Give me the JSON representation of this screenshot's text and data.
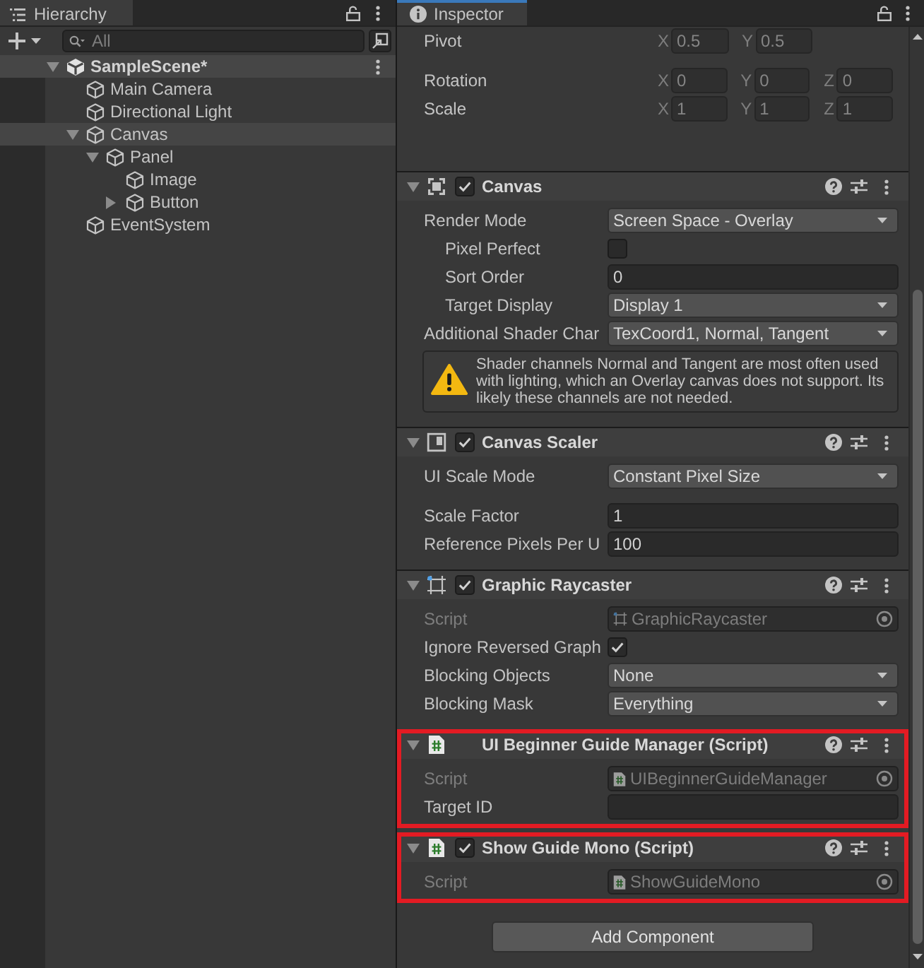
{
  "hierarchy": {
    "tab": {
      "label": "Hierarchy",
      "focused": false
    },
    "search": {
      "placeholder": "All"
    },
    "scene": {
      "name": "SampleScene*",
      "expanded": true,
      "children": [
        {
          "name": "Main Camera",
          "highlighted": false
        },
        {
          "name": "Directional Light",
          "highlighted": false
        },
        {
          "name": "Canvas",
          "highlighted": true,
          "expanded": true,
          "children": [
            {
              "name": "Panel",
              "highlighted": false,
              "expanded": true,
              "children": [
                {
                  "name": "Image",
                  "highlighted": false
                },
                {
                  "name": "Button",
                  "highlighted": false,
                  "expanded": false
                }
              ]
            }
          ]
        },
        {
          "name": "EventSystem",
          "highlighted": false
        }
      ]
    }
  },
  "inspector": {
    "tab": {
      "label": "Inspector",
      "focused": true
    },
    "transform": [
      [
        {
          "label": "Pivot",
          "disabled": true,
          "axes": [
            {
              "axis": "X",
              "value": "0.5"
            },
            {
              "axis": "Y",
              "value": "0.5"
            }
          ]
        }
      ],
      [
        {
          "label": "Rotation",
          "disabled": true,
          "axes": [
            {
              "axis": "X",
              "value": "0"
            },
            {
              "axis": "Y",
              "value": "0"
            },
            {
              "axis": "Z",
              "value": "0"
            }
          ]
        },
        {
          "label": "Scale",
          "disabled": true,
          "axes": [
            {
              "axis": "X",
              "value": "1"
            },
            {
              "axis": "Y",
              "value": "1"
            },
            {
              "axis": "Z",
              "value": "1"
            }
          ]
        }
      ]
    ],
    "components": [
      {
        "title": "Canvas",
        "kind": "canvas",
        "enabled": true,
        "highlighted": false,
        "groups": [
          [
            {
              "kind": "dropdown",
              "label": "Render Mode",
              "value": "Screen Space - Overlay",
              "disabled": false,
              "children": [
                {
                  "kind": "checkbox",
                  "label": "Pixel Perfect",
                  "checked": false,
                  "disabled": false
                },
                {
                  "kind": "input",
                  "label": "Sort Order",
                  "value": "0",
                  "disabled": false
                },
                {
                  "kind": "dropdown",
                  "label": "Target Display",
                  "value": "Display 1",
                  "disabled": false
                }
              ]
            },
            {
              "kind": "dropdown",
              "label": "Additional Shader Char",
              "value": "TexCoord1, Normal, Tangent",
              "disabled": false
            },
            {
              "kind": "warning",
              "text": "Shader channels Normal and Tangent are most often used with lighting, which an Overlay canvas does not support. Its likely these channels are not needed."
            }
          ]
        ]
      },
      {
        "title": "Canvas Scaler",
        "kind": "canvas_scaler",
        "enabled": true,
        "highlighted": false,
        "groups": [
          [
            {
              "kind": "dropdown",
              "label": "UI Scale Mode",
              "value": "Constant Pixel Size",
              "disabled": false
            }
          ],
          [
            {
              "kind": "input",
              "label": "Scale Factor",
              "value": "1",
              "disabled": false
            },
            {
              "kind": "input",
              "label": "Reference Pixels Per U",
              "value": "100",
              "disabled": false
            }
          ]
        ]
      },
      {
        "title": "Graphic Raycaster",
        "kind": "raycaster",
        "enabled": true,
        "highlighted": false,
        "groups": [
          [
            {
              "kind": "object",
              "label": "Script",
              "value": "GraphicRaycaster",
              "disabled": true
            },
            {
              "kind": "checkbox",
              "label": "Ignore Reversed Graph",
              "checked": true,
              "disabled": false
            },
            {
              "kind": "dropdown",
              "label": "Blocking Objects",
              "value": "None",
              "disabled": false
            },
            {
              "kind": "dropdown",
              "label": "Blocking Mask",
              "value": "Everything",
              "disabled": false
            }
          ]
        ]
      },
      {
        "title": "UI Beginner Guide Manager (Script)",
        "kind": "script",
        "highlighted": true,
        "groups": [
          [
            {
              "kind": "object",
              "label": "Script",
              "value": "UIBeginnerGuideManager",
              "disabled": true
            },
            {
              "kind": "input",
              "label": "Target ID",
              "disabled": false
            }
          ]
        ]
      },
      {
        "title": "Show Guide Mono (Script)",
        "kind": "script",
        "enabled": true,
        "highlighted": true,
        "groups": [
          [
            {
              "kind": "object",
              "label": "Script",
              "value": "ShowGuideMono",
              "disabled": true
            }
          ]
        ]
      }
    ],
    "add_button": "Add Component"
  }
}
